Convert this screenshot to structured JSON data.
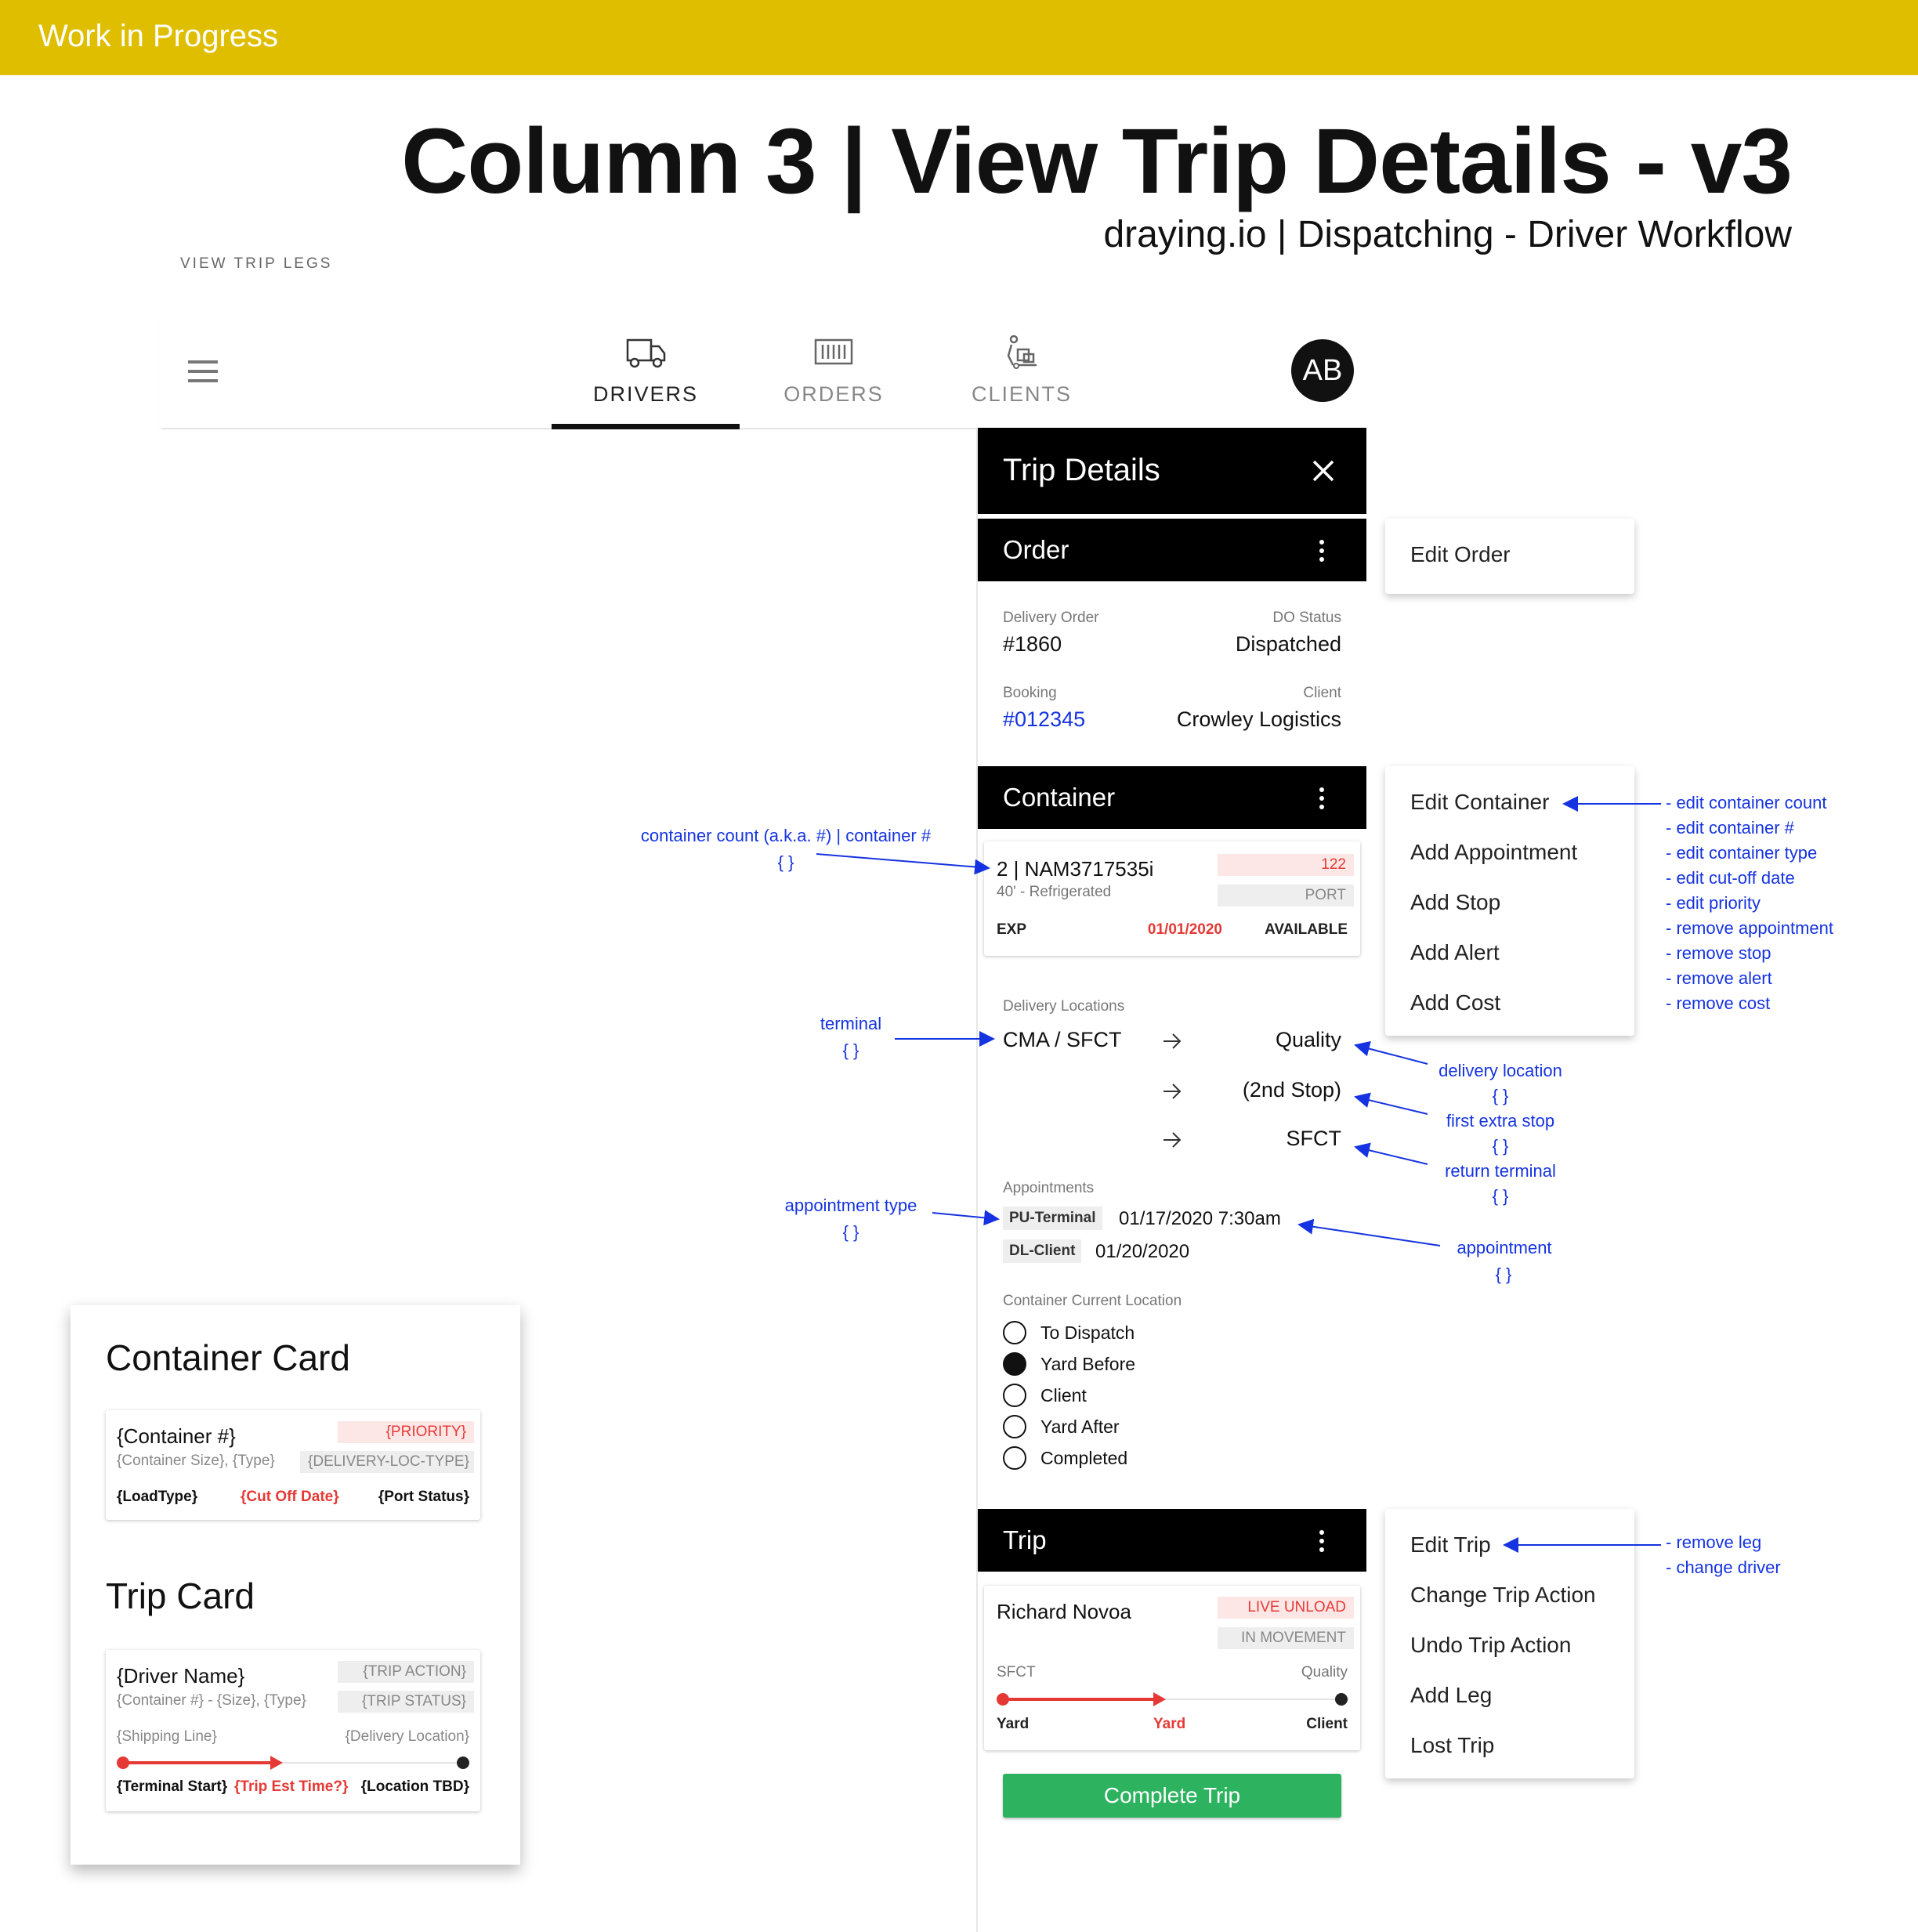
{
  "banner": "Work in Progress",
  "title": "Column 3 | View Trip Details - v3",
  "subtitle": "draying.io | Dispatching - Driver Workflow",
  "section_label": "VIEW TRIP LEGS",
  "nav": {
    "tabs": [
      {
        "label": "DRIVERS",
        "icon": "truck-icon",
        "active": true
      },
      {
        "label": "ORDERS",
        "icon": "container-icon",
        "active": false
      },
      {
        "label": "CLIENTS",
        "icon": "hand-truck-icon",
        "active": false
      }
    ],
    "avatar": "AB"
  },
  "panel": {
    "title": "Trip Details",
    "order": {
      "header": "Order",
      "delivery_order_label": "Delivery Order",
      "delivery_order": "#1860",
      "do_status_label": "DO Status",
      "do_status": "Dispatched",
      "booking_label": "Booking",
      "booking": "#012345",
      "client_label": "Client",
      "client": "Crowley Logistics"
    },
    "container": {
      "header": "Container",
      "card": {
        "title": "2 | NAM3717535i",
        "subtitle": "40' - Refrigerated",
        "priority": "122",
        "port": "PORT",
        "load_type": "EXP",
        "cutoff": "01/01/2020",
        "port_status": "AVAILABLE"
      },
      "delivery_locations_label": "Delivery Locations",
      "origin": "CMA / SFCT",
      "stops": [
        "Quality",
        "(2nd Stop)",
        "SFCT"
      ],
      "appointments_label": "Appointments",
      "appointments": [
        {
          "type": "PU-Terminal",
          "time": "01/17/2020 7:30am"
        },
        {
          "type": "DL-Client",
          "time": "01/20/2020"
        }
      ],
      "current_location_label": "Container Current Location",
      "locations": [
        {
          "label": "To Dispatch",
          "selected": false
        },
        {
          "label": "Yard Before",
          "selected": true
        },
        {
          "label": "Client",
          "selected": false
        },
        {
          "label": "Yard After",
          "selected": false
        },
        {
          "label": "Completed",
          "selected": false
        }
      ]
    },
    "trip": {
      "header": "Trip",
      "driver": "Richard Novoa",
      "action": "LIVE UNLOAD",
      "status": "IN MOVEMENT",
      "from": "SFCT",
      "to": "Quality",
      "start_label": "Yard",
      "mid_label": "Yard",
      "end_label": "Client",
      "progress": 0.45,
      "complete_button": "Complete Trip"
    }
  },
  "menus": {
    "order": [
      "Edit Order"
    ],
    "container": [
      "Edit Container",
      "Add Appointment",
      "Add Stop",
      "Add Alert",
      "Add Cost"
    ],
    "trip": [
      "Edit Trip",
      "Change Trip Action",
      "Undo Trip Action",
      "Add Leg",
      "Lost Trip"
    ]
  },
  "annotations": {
    "container_count": "container count (a.k.a. #) | container #",
    "braces": "{ }",
    "terminal": "terminal",
    "appointment_type": "appointment type",
    "delivery_location": "delivery location",
    "first_extra_stop": "first extra stop",
    "return_terminal": "return terminal",
    "appointment": "appointment",
    "container_edits": [
      "- edit container count",
      "- edit container #",
      "- edit container type",
      "- edit cut-off date",
      "- edit priority",
      "- remove appointment",
      "- remove stop",
      "- remove alert",
      "- remove cost"
    ],
    "trip_edits": [
      "- remove leg",
      "- change driver"
    ]
  },
  "legend": {
    "container_card_title": "Container Card",
    "container_card": {
      "number": "{Container #}",
      "sub": "{Container Size}, {Type}",
      "priority": "{PRIORITY}",
      "loc_type": "{DELIVERY-LOC-TYPE}",
      "load_type": "{LoadType}",
      "cutoff": "{Cut Off Date}",
      "port_status": "{Port Status}"
    },
    "trip_card_title": "Trip Card",
    "trip_card": {
      "driver": "{Driver Name}",
      "sub": "{Container #} - {Size}, {Type}",
      "action": "{TRIP ACTION}",
      "status": "{TRIP STATUS}",
      "shipping_line": "{Shipping Line}",
      "delivery_location": "{Delivery Location}",
      "start": "{Terminal Start}",
      "eta": "{Trip Est Time?}",
      "end": "{Location TBD}"
    }
  },
  "colors": {
    "banner": "#DFBE00",
    "annotation": "#1533E0",
    "accent_red": "#E53935",
    "complete_green": "#2DB35F"
  }
}
